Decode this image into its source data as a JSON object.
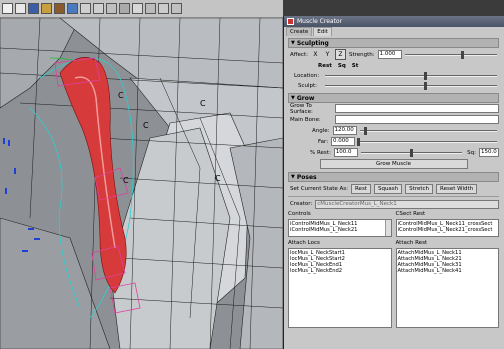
{
  "viewport": {
    "toolbar_icons": [
      "select-icon",
      "camera-icon",
      "camera-icon",
      "display-icon",
      "display-icon",
      "shade-icon",
      "shade-icon",
      "texture-icon",
      "light-icon",
      "grid-icon",
      "isolate-icon",
      "film-icon",
      "wire-icon",
      "xray-icon"
    ],
    "control_labels": [
      "C",
      "C",
      "C",
      "C",
      "C"
    ],
    "colors": {
      "muscle": "#d63a3a",
      "mesh": "#1a1a1a",
      "bg": "#8f9296"
    }
  },
  "window": {
    "title": "Muscle Creator",
    "tabs": [
      "Create",
      "Edit"
    ],
    "sculpting": {
      "header": "Sculpting",
      "affect_label": "Affect:",
      "axes": [
        "X",
        "Y",
        "Z"
      ],
      "strength_label": "Strength:",
      "strength_value": "1.000",
      "strength_level": 0.62,
      "modes": [
        "Rest",
        "Sq",
        "St"
      ],
      "location_label": "Location:",
      "location_level": 0.58,
      "sculpt_label": "Sculpt:",
      "sculpt_level": 0.58
    },
    "grow": {
      "header": "Grow",
      "grow_to_surface_label": "Grow To Surface:",
      "main_bone_label": "Main Bone:",
      "angle_label": "Angle:",
      "angle_value": "120.00",
      "angle_level": 0.04,
      "far_label": "Far:",
      "far_value": "0.000",
      "far_level": 0.0,
      "rest_label": "% Rest:",
      "rest_value": "100.0",
      "rest_level": 0.5,
      "sq_label": "Sq:",
      "sq_value": "150.0",
      "grow_button": "Grow Muscle"
    },
    "poses": {
      "header": "Poses",
      "set_state_label": "Set Current State As:",
      "buttons": [
        "Rest",
        "Squash",
        "Stretch",
        "Reset Width"
      ]
    },
    "creator_label": "Creator:",
    "creator_value": "cMuscleCreatorMus_L_Neck1",
    "controls_label": "Controls",
    "controls": [
      "iControlMidMus_L_Neck11",
      "iControlMidMus_L_Neck21"
    ],
    "csect_label": "CSect Rest",
    "csect": [
      "iControlMidMus_L_Neck11_crossSect",
      "iControlMidMus_L_Neck21_crossSect"
    ],
    "attach_locs_label": "Attach Locs",
    "attach_locs": [
      "locMus_L_NeckStart1",
      "locMus_L_NeckStart2",
      "locMus_L_NeckEnd1",
      "locMus_L_NeckEnd2"
    ],
    "attach_rest_label": "Attach Rest",
    "attach_rest": [
      "AttachMidMus_L_Neck11",
      "AttachMidMus_L_Neck21",
      "AttachMidMus_L_Neck31",
      "AttachMidMus_L_Neck41"
    ]
  }
}
